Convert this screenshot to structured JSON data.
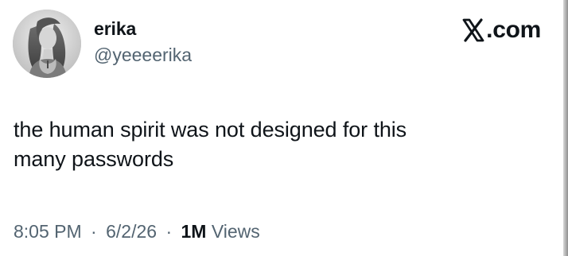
{
  "post": {
    "author": {
      "display_name": "erika",
      "handle": "@yeeeerika",
      "avatar_icon": "profile-photo-avatar"
    },
    "brand": {
      "icon": "x-logo-icon",
      "suffix": ".com"
    },
    "text_lines": [
      "the human spirit was not designed for this",
      "many passwords"
    ],
    "meta": {
      "time": "8:05 PM",
      "separator": "·",
      "date": "6/2/26",
      "views_count": "1M",
      "views_label": "Views"
    }
  },
  "colors": {
    "text_primary": "#0f1419",
    "text_secondary": "#536471",
    "background": "#ffffff"
  }
}
